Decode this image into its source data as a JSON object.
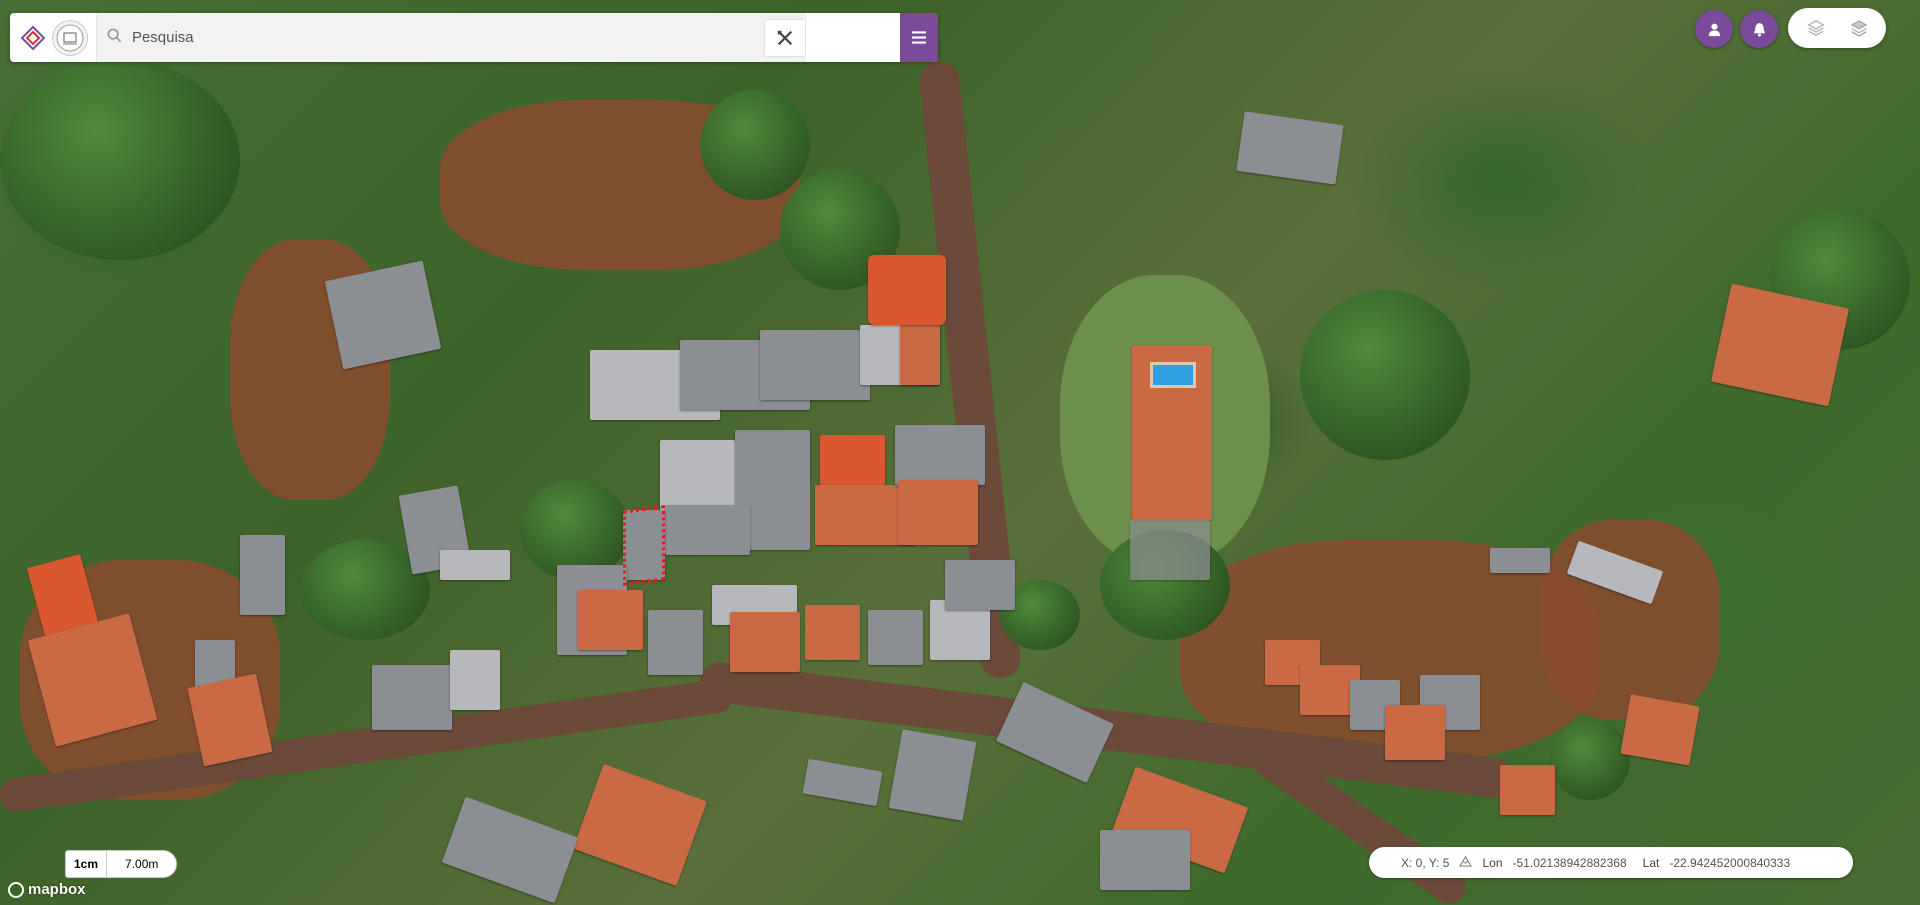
{
  "app": {
    "search": {
      "placeholder": "Pesquisa",
      "value": ""
    },
    "buttons": {
      "tools_icon": "ruler-pencil-icon",
      "menu_icon": "hamburger-icon",
      "profile_icon": "user-icon",
      "notifications_icon": "bell-icon",
      "layers": [
        "layers-outline-icon",
        "layers-stack-icon"
      ]
    },
    "colors": {
      "accent": "#7b4b9b",
      "selection": "#e02020"
    }
  },
  "map": {
    "scale": {
      "unit": "1cm",
      "value": "7.00m"
    },
    "attribution": "mapbox",
    "cursor": {
      "xy_label": "X: 0, Y: 5",
      "lon_label": "Lon",
      "lon_value": "-51.02138942882368",
      "lat_label": "Lat",
      "lat_value": "-22.942452000840333"
    }
  }
}
